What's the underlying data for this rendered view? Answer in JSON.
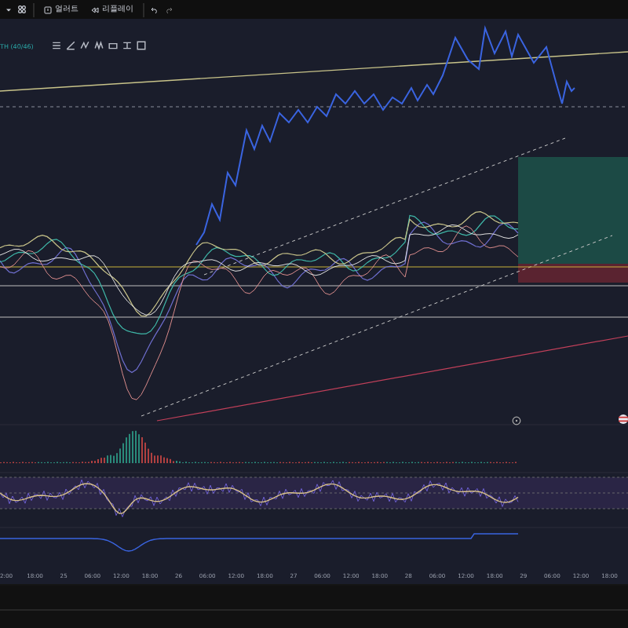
{
  "toolbar": {
    "buttons": [
      {
        "kind": "alert",
        "label": "얼러트"
      },
      {
        "kind": "replay",
        "label": "리플레이"
      }
    ]
  },
  "legend": {
    "label": "TH (40/46)"
  },
  "time_axis": {
    "labels": [
      "2:00",
      "18:00",
      "25",
      "06:00",
      "12:00",
      "18:00",
      "26",
      "06:00",
      "12:00",
      "18:00",
      "27",
      "06:00",
      "12:00",
      "18:00",
      "28",
      "06:00",
      "12:00",
      "18:00",
      "29",
      "06:00",
      "12:00",
      "18:00"
    ]
  }
}
